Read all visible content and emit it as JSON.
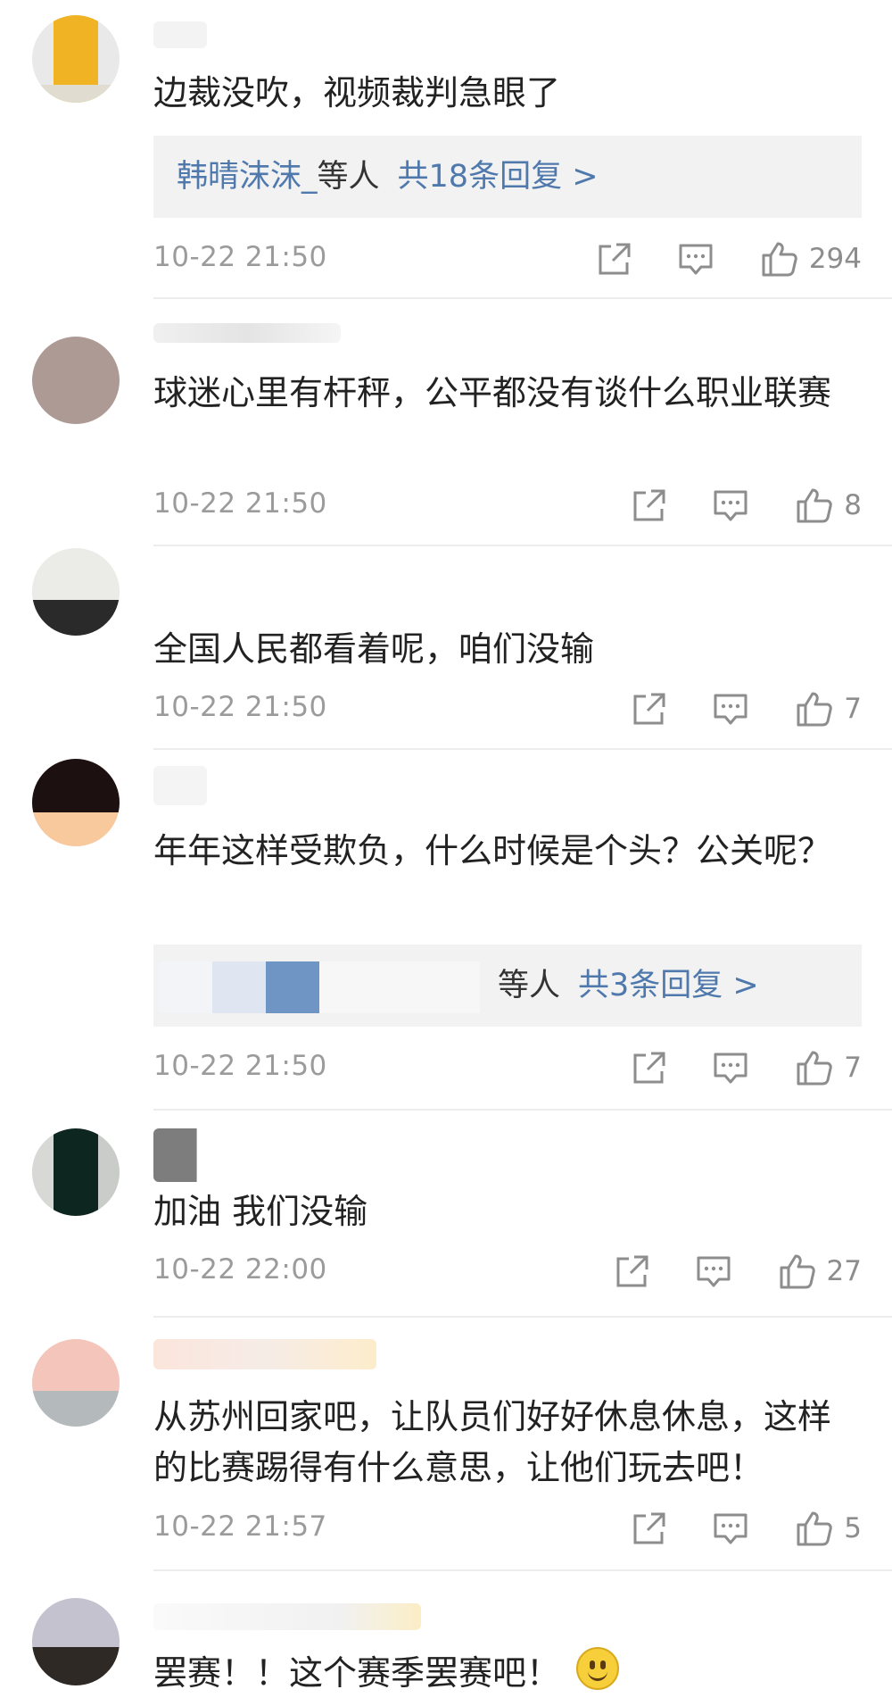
{
  "comments": [
    {
      "text": "边裁没吹，视频裁判急眼了",
      "reply_names": "韩晴沫沫_",
      "reply_suffix": "等人",
      "reply_count": "共18条回复 >",
      "time": "10-22 21:50",
      "likes": "294"
    },
    {
      "text": "球迷心里有杆秤，公平都没有谈什么职业联赛",
      "time": "10-22 21:50",
      "likes": "8"
    },
    {
      "text": "全国人民都看着呢，咱们没输",
      "time": "10-22 21:50",
      "likes": "7"
    },
    {
      "text": "年年这样受欺负，什么时候是个头？公关呢？",
      "reply_suffix": "等人",
      "reply_count": "共3条回复 >",
      "time": "10-22 21:50",
      "likes": "7"
    },
    {
      "text": "加油 我们没输",
      "time": "10-22 22:00",
      "likes": "27"
    },
    {
      "text": "从苏州回家吧，让队员们好好休息休息，这样的比赛踢得有什么意思，让他们玩去吧！",
      "time": "10-22 21:57",
      "likes": "5"
    },
    {
      "text": "罢赛！！这个赛季罢赛吧！",
      "emoji": "smile-emoji"
    }
  ],
  "icons": {
    "share": "share-icon",
    "comment": "comment-icon",
    "like": "thumbs-up-icon"
  },
  "colors": {
    "link": "#4f79ad",
    "meta": "#9b9b9b",
    "text": "#222222",
    "reply_bg": "#f2f2f2"
  }
}
